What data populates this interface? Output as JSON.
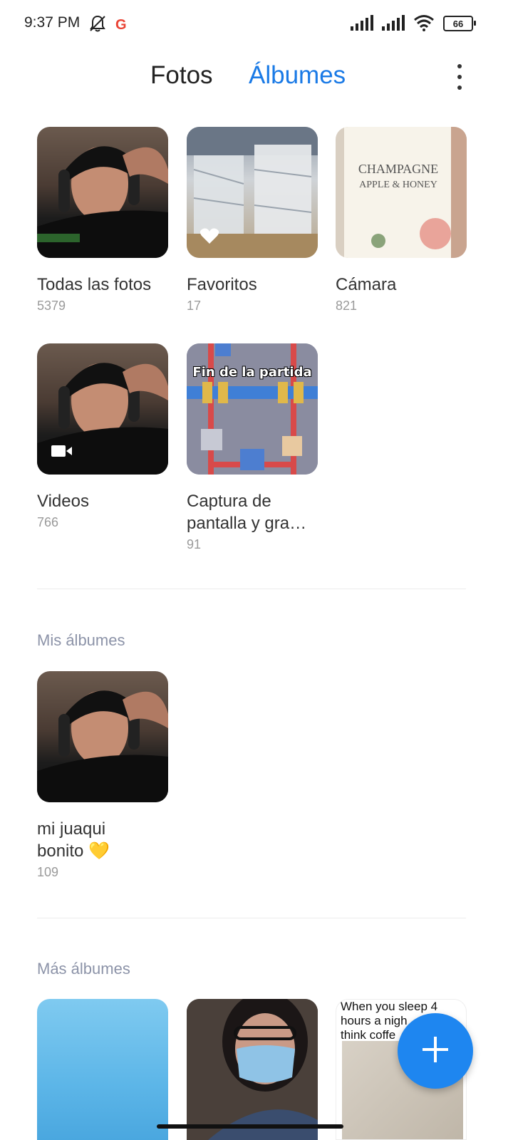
{
  "status": {
    "time": "9:37 PM",
    "battery": "66",
    "google_letter": "G"
  },
  "tabs": [
    {
      "label": "Fotos",
      "active": false
    },
    {
      "label": "Álbumes",
      "active": true
    }
  ],
  "accent_color": "#1a7ae6",
  "main_albums": [
    {
      "title": "Todas las fotos",
      "count": "5379",
      "thumb": "selfie-photo"
    },
    {
      "title": "Favoritos",
      "count": "17",
      "thumb": "wrapped-machines-photo",
      "overlay_icon": "heart-icon"
    },
    {
      "title": "Cámara",
      "count": "821",
      "thumb": "lotion-bottle-photo"
    },
    {
      "title": "Videos",
      "count": "766",
      "thumb": "selfie-photo",
      "overlay_icon": "video-camera-icon"
    },
    {
      "title": "Captura de pantalla y gra…",
      "title_line1": "Captura de",
      "title_line2": "pantalla y gra…",
      "count": "91",
      "thumb": "game-screenshot",
      "thumb_text": "Fin de la partida"
    }
  ],
  "sections": {
    "mis_albumes": "Mis álbumes",
    "mas_albumes": "Más álbumes"
  },
  "my_albums": [
    {
      "title_line1": "mi juaqui",
      "title_line2": "bonito 💛",
      "count": "109",
      "thumb": "selfie-photo"
    }
  ],
  "more_albums": [
    {
      "thumb": "blue-watercolor-image"
    },
    {
      "thumb": "masked-person-photo"
    },
    {
      "thumb": "meme-image",
      "thumb_text_line1": "When you sleep 4",
      "thumb_text_line2": "hours a nigh",
      "thumb_text_line3": "think coffe"
    }
  ]
}
